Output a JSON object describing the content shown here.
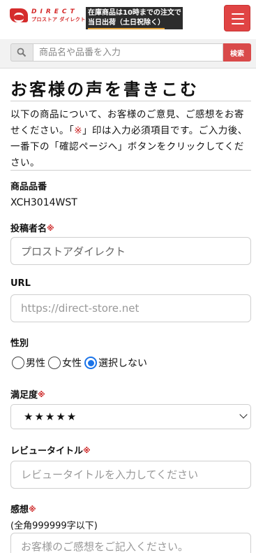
{
  "header": {
    "logo_word": "DIRECT",
    "logo_sub": "プロストア ダイレクト",
    "banner_line1": "在庫商品は10時までの注文で",
    "banner_line2": "当日出荷（土日祝除く）",
    "menu_icon": "hamburger-icon",
    "accent_color": "#e04444"
  },
  "search": {
    "placeholder": "商品名や品番を入力",
    "button_label": "検索",
    "icon": "search-icon"
  },
  "page": {
    "title": "お客様の声を書きこむ",
    "intro_before": "以下の商品について、お客様のご意見、ご感想をお寄せください。「",
    "intro_mark": "※",
    "intro_after": "」印は入力必須項目です。ご入力後、一番下の「確認ページへ」ボタンをクリックしてください。"
  },
  "form": {
    "required_mark": "※",
    "product_code": {
      "label": "商品品番",
      "value": "XCH3014WST"
    },
    "poster_name": {
      "label": "投稿者名",
      "value": "プロストアダイレクト"
    },
    "url": {
      "label": "URL",
      "placeholder": "https://direct-store.net"
    },
    "gender": {
      "label": "性別",
      "options": [
        "男性",
        "女性",
        "選択しない"
      ],
      "selected": "選択しない"
    },
    "satisfaction": {
      "label": "満足度",
      "value": "★★★★★"
    },
    "review_title": {
      "label": "レビュータイトル",
      "placeholder": "レビュータイトルを入力してください"
    },
    "impression": {
      "label": "感想",
      "note": "(全角999999字以下)",
      "placeholder": "お客様のご感想をご記入ください。"
    }
  }
}
